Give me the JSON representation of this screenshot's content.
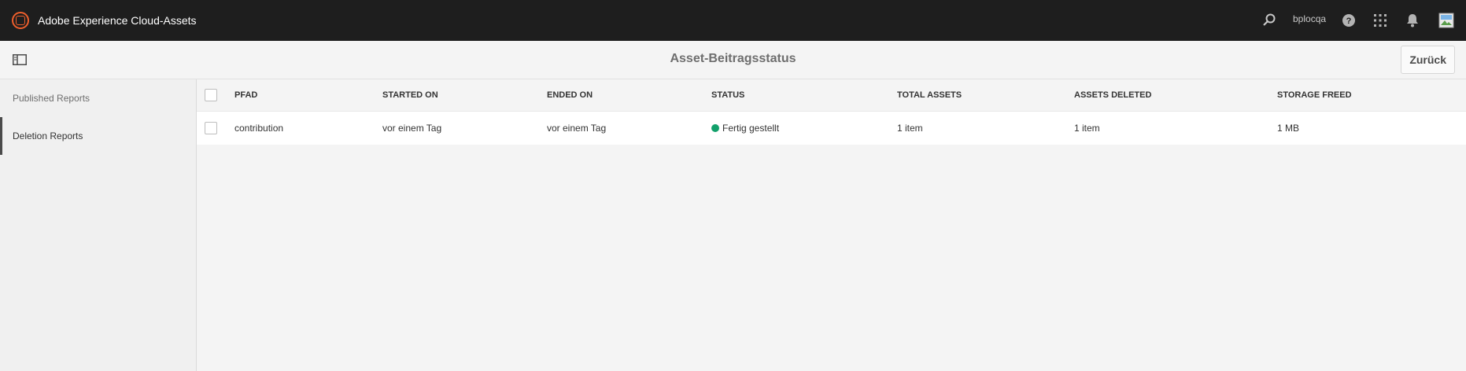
{
  "app": {
    "title": "Adobe Experience Cloud-Assets"
  },
  "header": {
    "user": "bplocqa"
  },
  "page": {
    "title": "Asset-Beitragsstatus",
    "back_label": "Zurück"
  },
  "sidebar": {
    "items": [
      {
        "label": "Published Reports"
      },
      {
        "label": "Deletion Reports"
      }
    ]
  },
  "table": {
    "columns": [
      "PFAD",
      "STARTED ON",
      "ENDED ON",
      "STATUS",
      "TOTAL ASSETS",
      "ASSETS DELETED",
      "STORAGE FREED"
    ],
    "rows": [
      {
        "path": "contribution",
        "started": "vor einem Tag",
        "ended": "vor einem Tag",
        "status": "Fertig gestellt",
        "total": "1 item",
        "deleted": "1 item",
        "freed": "1 MB"
      }
    ]
  },
  "colors": {
    "topbar": "#1e1e1e",
    "brand": "#ef5f2c",
    "status_ok": "#12a06b"
  }
}
